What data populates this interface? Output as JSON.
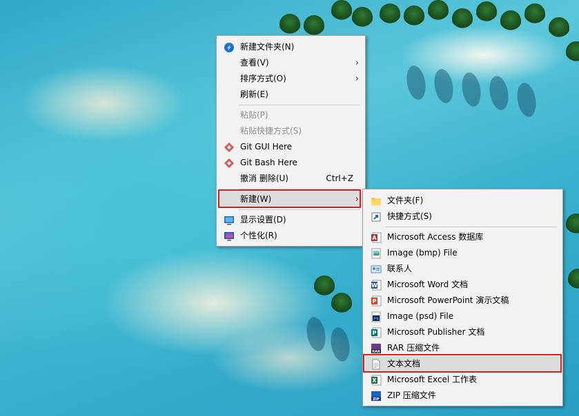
{
  "main_menu": {
    "items": [
      {
        "label": "新建文件夹(N)",
        "icon": "new-folder-icon"
      },
      {
        "label": "查看(V)",
        "submenu": true
      },
      {
        "label": "排序方式(O)",
        "submenu": true
      },
      {
        "label": "刷新(E)"
      },
      {
        "label": "粘贴(P)",
        "disabled": true
      },
      {
        "label": "粘贴快捷方式(S)",
        "disabled": true
      },
      {
        "label": "Git GUI Here",
        "icon": "git-icon"
      },
      {
        "label": "Git Bash Here",
        "icon": "git-icon"
      },
      {
        "label": "撤消 删除(U)",
        "shortcut": "Ctrl+Z"
      },
      {
        "label": "新建(W)",
        "submenu": true,
        "highlighted": true
      },
      {
        "label": "显示设置(D)",
        "icon": "display-icon"
      },
      {
        "label": "个性化(R)",
        "icon": "personalize-icon"
      }
    ],
    "arrow": "›"
  },
  "new_submenu": {
    "items": [
      {
        "label": "文件夹(F)",
        "icon": "folder-icon"
      },
      {
        "label": "快捷方式(S)",
        "icon": "shortcut-icon"
      },
      {
        "label": "Microsoft Access 数据库",
        "icon": "access-icon"
      },
      {
        "label": "Image (bmp) File",
        "icon": "bmp-icon"
      },
      {
        "label": "联系人",
        "icon": "contact-icon"
      },
      {
        "label": "Microsoft Word 文档",
        "icon": "word-icon"
      },
      {
        "label": "Microsoft PowerPoint 演示文稿",
        "icon": "powerpoint-icon"
      },
      {
        "label": "Image (psd) File",
        "icon": "psd-icon"
      },
      {
        "label": "Microsoft Publisher 文档",
        "icon": "publisher-icon"
      },
      {
        "label": "RAR 压缩文件",
        "icon": "rar-icon"
      },
      {
        "label": "文本文档",
        "icon": "text-doc-icon",
        "highlighted": true
      },
      {
        "label": "Microsoft Excel 工作表",
        "icon": "excel-icon"
      },
      {
        "label": "ZIP 压缩文件",
        "icon": "zip-icon"
      }
    ]
  },
  "colors": {
    "highlight_box": "#d32020",
    "menu_bg": "#f2f2f2",
    "hover_bg": "#dcdcdc"
  }
}
